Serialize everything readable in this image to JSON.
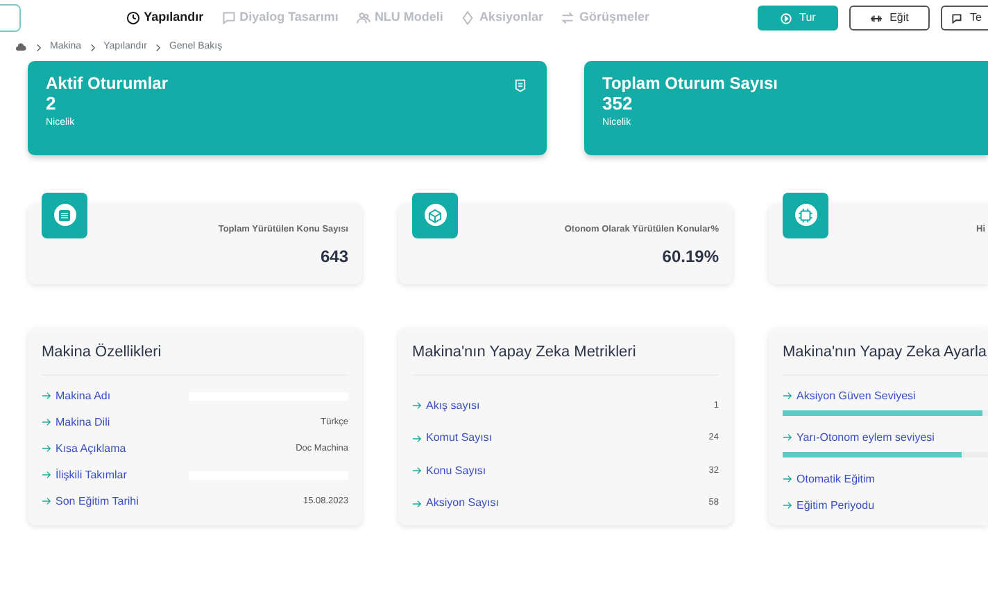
{
  "nav": [
    {
      "label": "Yapılandır",
      "selected": true
    },
    {
      "label": "Diyalog Tasarımı",
      "selected": false
    },
    {
      "label": "NLU Modeli",
      "selected": false
    },
    {
      "label": "Aksiyonlar",
      "selected": false
    },
    {
      "label": "Görüşmeler",
      "selected": false
    }
  ],
  "actions": [
    {
      "label": "Tur",
      "kind": "primary"
    },
    {
      "label": "Eğit",
      "kind": "train"
    },
    {
      "label": "Te",
      "kind": "chat"
    }
  ],
  "breadcrumb": [
    "Makina",
    "Yapılandır",
    "Genel Bakış"
  ],
  "summary_cards": [
    {
      "title": "Aktif Oturumlar",
      "value": "2",
      "caption": "Nicelik",
      "has_icon": true
    },
    {
      "title": "Toplam Oturum Sayısı",
      "value": "352",
      "caption": "Nicelik",
      "has_icon": false
    }
  ],
  "stats": [
    {
      "label": "Toplam Yürütülen Konu Sayısı",
      "value": "643"
    },
    {
      "label": "Otonom Olarak Yürütülen Konular%",
      "value": "60.19%"
    },
    {
      "label": "Hi"
    }
  ],
  "properties": {
    "title": "Makina Özellikleri",
    "rows": [
      {
        "label": "Makina Adı",
        "redacted": true
      },
      {
        "label": "Makina Dili",
        "redacted": false,
        "value": "Türkçe"
      },
      {
        "label": "Kısa Açıklama",
        "redacted": false,
        "value": "Doc Machina"
      },
      {
        "label": "İlişkili Takımlar",
        "redacted": true
      },
      {
        "label": "Son Eğitim Tarihi",
        "redacted": false,
        "value": "15.08.2023"
      }
    ]
  },
  "metrics": {
    "title": "Makina'nın Yapay Zeka Metrikleri",
    "rows": [
      {
        "label": "Akış sayısı",
        "value": "1"
      },
      {
        "label": "Komut Sayısı",
        "value": "24"
      },
      {
        "label": "Konu Sayısı",
        "value": "32"
      },
      {
        "label": "Aksiyon Sayısı",
        "value": "58"
      }
    ]
  },
  "settings": {
    "title": "Makina'nın Yapay Zeka Ayarla",
    "rows": [
      {
        "label": "Aksiyon Güven Seviyesi",
        "kind": "slider",
        "level": 0.97
      },
      {
        "label": "Yarı-Otonom eylem seviyesi",
        "kind": "slider",
        "level": 0.87
      },
      {
        "label": "Otomatik Eğitim",
        "kind": "link"
      },
      {
        "label": "Eğitim Periyodu",
        "kind": "link"
      }
    ]
  }
}
